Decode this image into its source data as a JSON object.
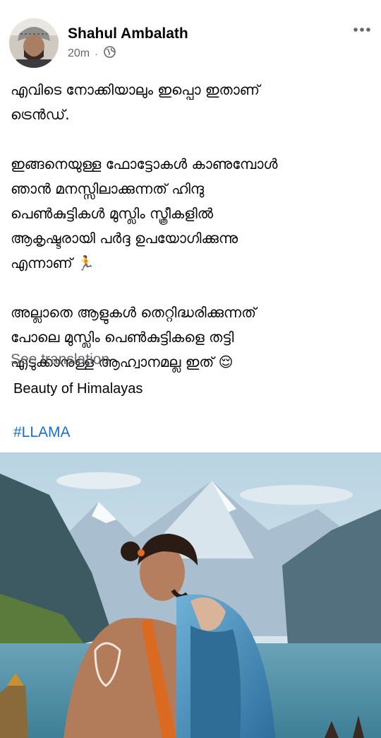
{
  "post": {
    "author": "Shahul Ambalath",
    "time": "20m",
    "separator": "·",
    "audience_icon": "globe-icon",
    "more_icon": "more-horizontal-icon",
    "text_paragraphs": [
      [
        "എവിടെ നോക്കിയാലും ഇപ്പൊ ഇതാണ്",
        "ട്രെൻഡ്."
      ],
      [
        "ഇങ്ങനെയുള്ള ഫോട്ടോകൾ കാണുമ്പോൾ",
        "ഞാൻ മനസ്സിലാക്കുന്നത് ഹിന്ദു",
        "പെൺകുട്ടികൾ മുസ്ലിം സ്ത്രീകളിൽ",
        "ആകൃഷ്ടരായി പർദ്ദ ഉപയോഗിക്കുന്നു",
        "എന്നാണ് 🏃"
      ],
      [
        "അല്ലാതെ ആളുകൾ തെറ്റിദ്ധരിക്കുന്നത്",
        "പോലെ മുസ്ലിം പെൺകുട്ടികളെ തട്ടി",
        "എടുക്കാനുള്ള ആഹ്വാനമല്ല ഇത് 😌"
      ]
    ],
    "see_translation": "See translation",
    "caption": "Beauty of Himalayas",
    "hashtag": "#LLAMA"
  },
  "colors": {
    "text": "#050505",
    "secondary": "#65676b",
    "link": "#1a6fc9"
  }
}
